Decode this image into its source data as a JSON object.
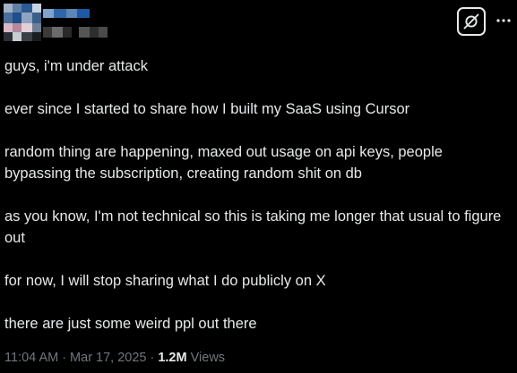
{
  "post": {
    "paragraphs": [
      "guys, i'm under attack",
      "ever since I started to share how I built my SaaS using Cursor",
      "random thing are happening, maxed out usage on api keys, people bypassing the subscription, creating random shit on db",
      "as you know, I'm not technical so this is taking me longer that usual to figure out",
      "for now, I will stop sharing what I do publicly on X",
      "there are just some weird ppl out there"
    ],
    "time": "11:04 AM",
    "separator": "·",
    "date": "Mar 17, 2025",
    "views_count": "1.2M",
    "views_label": "Views"
  },
  "icons": {
    "grok": "grok-icon",
    "more": "more-dots-icon"
  },
  "colors": {
    "background": "#000000",
    "text": "#e7e9ea",
    "secondary_text": "#71767b"
  }
}
